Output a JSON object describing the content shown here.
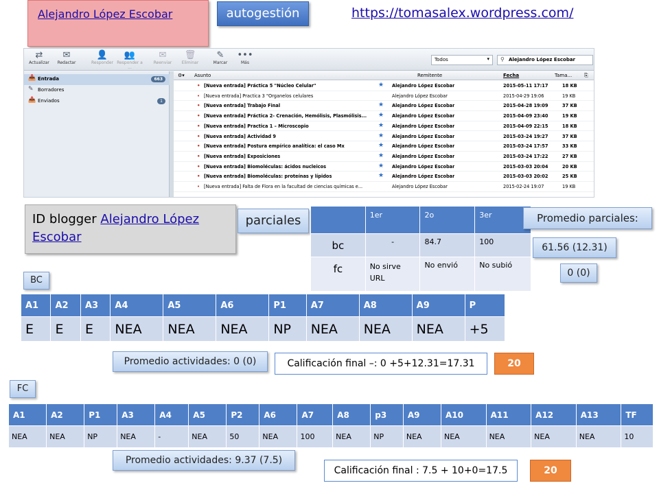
{
  "header": {
    "name_link": "Alejandro López Escobar",
    "autogestion": "autogestión",
    "url": "https://tomasalex.wordpress.com/"
  },
  "mail": {
    "toolbar": [
      {
        "label": "Actualizar",
        "icon": "refresh-icon",
        "glyph": "⇄",
        "enabled": true
      },
      {
        "label": "Redactar",
        "icon": "compose-icon",
        "glyph": "✉",
        "enabled": true
      },
      {
        "label": "Responder",
        "icon": "reply-icon",
        "glyph": "👤",
        "enabled": false
      },
      {
        "label": "Responder a ...",
        "icon": "reply-all-icon",
        "glyph": "👥",
        "enabled": false
      },
      {
        "label": "Reenviar",
        "icon": "forward-icon",
        "glyph": "✉",
        "enabled": false
      },
      {
        "label": "Eliminar",
        "icon": "delete-icon",
        "glyph": "🗑",
        "enabled": false
      },
      {
        "label": "Marcar",
        "icon": "mark-icon",
        "glyph": "✎",
        "enabled": true
      },
      {
        "label": "Más",
        "icon": "more-icon",
        "glyph": "•••",
        "enabled": true
      }
    ],
    "filter": "Todos",
    "search": "Alejandro López Escobar",
    "folders": [
      {
        "label": "Entrada",
        "count": "663",
        "icon": "inbox-icon",
        "glyph": "📥",
        "selected": true
      },
      {
        "label": "Borradores",
        "count": "",
        "icon": "drafts-icon",
        "glyph": "✎",
        "selected": false
      },
      {
        "label": "Enviados",
        "count": "1",
        "icon": "sent-icon",
        "glyph": "📤",
        "selected": false
      }
    ],
    "columns": {
      "subject": "Asunto",
      "sender": "Remitente",
      "date": "Fecha",
      "size": "Tama..."
    },
    "rows": [
      {
        "subject": "[Nueva entrada] Práctica 5 \"Núcleo Celular\"",
        "sender": "Alejandro López Escobar",
        "date": "2015-05-11 17:17",
        "size": "18 KB",
        "unread": true,
        "starred": true
      },
      {
        "subject": "[Nueva entrada] Practica 3 \"Organelos celulares",
        "sender": "Alejandro López Escobar",
        "date": "2015-04-29 19:06",
        "size": "19 KB",
        "unread": false,
        "starred": false
      },
      {
        "subject": "[Nueva entrada] Trabajo Final",
        "sender": "Alejandro López Escobar",
        "date": "2015-04-28 19:09",
        "size": "37 KB",
        "unread": true,
        "starred": true
      },
      {
        "subject": "[Nueva entrada] Práctica 2- Crenación, Hemólisis, Plasmólisis...",
        "sender": "Alejandro López Escobar",
        "date": "2015-04-09 23:40",
        "size": "19 KB",
        "unread": true,
        "starred": true
      },
      {
        "subject": "[Nueva entrada] Practica 1 – Microscopio",
        "sender": "Alejandro López Escobar",
        "date": "2015-04-09 22:15",
        "size": "18 KB",
        "unread": true,
        "starred": true
      },
      {
        "subject": "[Nueva entrada] Actividad 9",
        "sender": "Alejandro López Escobar",
        "date": "2015-03-24 19:27",
        "size": "37 KB",
        "unread": true,
        "starred": true
      },
      {
        "subject": "[Nueva entrada] Postura empírico analítica: el caso Mx",
        "sender": "Alejandro López Escobar",
        "date": "2015-03-24 17:57",
        "size": "33 KB",
        "unread": true,
        "starred": true
      },
      {
        "subject": "[Nueva entrada] Exposiciones",
        "sender": "Alejandro López Escobar",
        "date": "2015-03-24 17:22",
        "size": "27 KB",
        "unread": true,
        "starred": true
      },
      {
        "subject": "[Nueva entrada] Biomoléculas: ácidos nucleicos",
        "sender": "Alejandro López Escobar",
        "date": "2015-03-03 20:04",
        "size": "20 KB",
        "unread": true,
        "starred": true
      },
      {
        "subject": "[Nueva entrada] Biomoléculas: proteínas y lípidos",
        "sender": "Alejandro López Escobar",
        "date": "2015-03-03 20:02",
        "size": "25 KB",
        "unread": true,
        "starred": true
      },
      {
        "subject": "[Nueva entrada] Falta de Flora en la facultad de ciencias químicas e...",
        "sender": "Alejandro López Escobar",
        "date": "2015-02-24 19:07",
        "size": "19 KB",
        "unread": false,
        "starred": false
      }
    ]
  },
  "id_blogger": {
    "label": "ID blogger",
    "link": "Alejandro López Escobar"
  },
  "parciales": {
    "label": "parciales",
    "headers": [
      "",
      "1er",
      "2o",
      "3er"
    ],
    "rows": [
      [
        "bc",
        "-",
        "84.7",
        "100"
      ],
      [
        "fc",
        "No sirve URL",
        "No envió",
        "No subió"
      ]
    ],
    "promedio_label": "Promedio parciales:",
    "promedio_bc": "61.56 (12.31)",
    "promedio_fc": "0 (0)"
  },
  "bc": {
    "label": "BC",
    "headers": [
      "A1",
      "A2",
      "A3",
      "A4",
      "A5",
      "A6",
      "P1",
      "A7",
      "A8",
      "A9",
      "P"
    ],
    "values": [
      "E",
      "E",
      "E",
      "NEA",
      "NEA",
      "NEA",
      "NP",
      "NEA",
      "NEA",
      "NEA",
      "+5"
    ],
    "promedio": "Promedio actividades: 0 (0)",
    "calificacion": "Calificación final –: 0 +5+12.31=17.31",
    "total": "20"
  },
  "fc": {
    "label": "FC",
    "headers": [
      "A1",
      "A2",
      "P1",
      "A3",
      "A4",
      "A5",
      "P2",
      "A6",
      "A7",
      "A8",
      "p3",
      "A9",
      "A10",
      "A11",
      "A12",
      "A13",
      "TF"
    ],
    "values": [
      "NEA",
      "NEA",
      "NP",
      "NEA",
      "-",
      "NEA",
      "50",
      "NEA",
      "100",
      "NEA",
      "NP",
      "NEA",
      "NEA",
      "NEA",
      "NEA",
      "NEA",
      "10"
    ],
    "promedio": "Promedio actividades: 9.37 (7.5)",
    "calificacion": "Calificación final : 7.5 + 10+0=17.5",
    "total": "20"
  },
  "colors": {
    "header_blue": "#4f7fc7",
    "cell_light": "#cfd9ec",
    "orange": "#f0883e",
    "pink": "#f2a9ab"
  }
}
